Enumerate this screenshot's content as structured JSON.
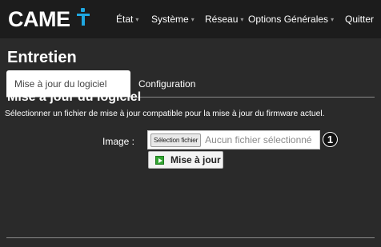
{
  "brand": {
    "logo_text": "CAME"
  },
  "nav": {
    "items": [
      {
        "label": "État",
        "has_caret": true
      },
      {
        "label": "Système",
        "has_caret": true
      },
      {
        "label": "Réseau",
        "has_caret": true
      },
      {
        "label": "Options Générales",
        "has_caret": true
      },
      {
        "label": "Quitter",
        "has_caret": false
      }
    ],
    "caret_glyph": "▾"
  },
  "page": {
    "title": "Entretien",
    "tabs": [
      {
        "label": "Mise à jour du logiciel",
        "active": true
      },
      {
        "label": "Configuration",
        "active": false
      }
    ]
  },
  "section": {
    "title": "Mise à jour du logiciel",
    "description": "Sélectionner un fichier de mise à jour compatible pour la mise à jour du firmware actuel.",
    "field_label": "Image :",
    "file_button_label": "Sélection fichier",
    "file_status": "Aucun fichier sélectionné",
    "callout_number": "1",
    "update_button_label": "Mise à jour"
  },
  "colors": {
    "accent": "#1fa7e0",
    "background": "#2a2a2a",
    "topbar": "#1c1c1c",
    "update_icon": "#33a532"
  },
  "icons": {
    "update_button": "play-icon"
  }
}
